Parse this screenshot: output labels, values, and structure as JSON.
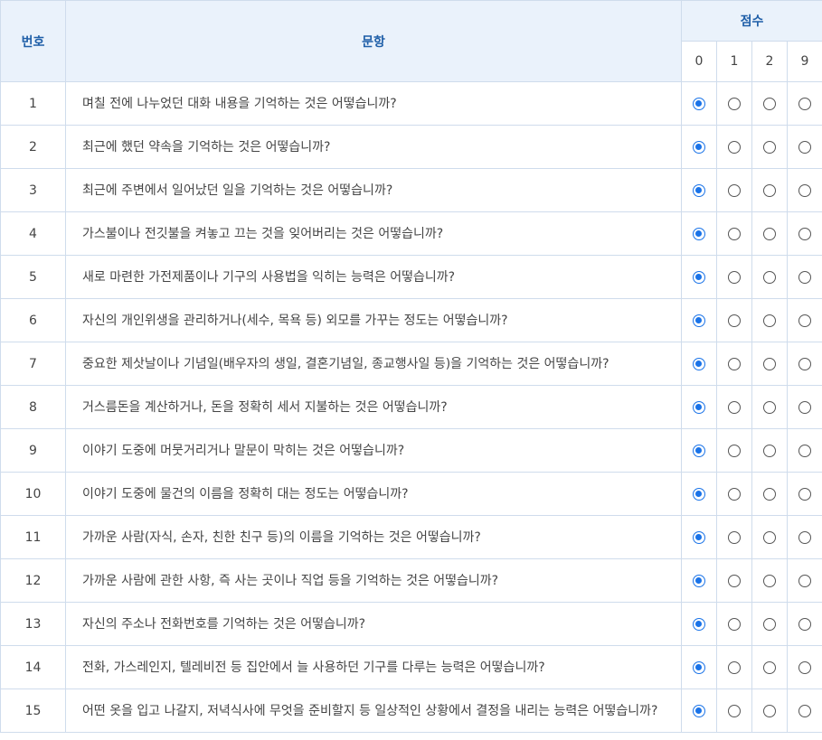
{
  "header": {
    "col_number": "번호",
    "col_question": "문항",
    "col_score": "점수",
    "score_options": [
      "0",
      "1",
      "2",
      "9"
    ]
  },
  "rows": [
    {
      "num": "1",
      "text": "며칠 전에 나누었던 대화 내용을 기억하는 것은 어떻습니까?",
      "selected": "0"
    },
    {
      "num": "2",
      "text": "최근에 했던 약속을 기억하는 것은 어떻습니까?",
      "selected": "0"
    },
    {
      "num": "3",
      "text": "최근에 주변에서 일어났던 일을 기억하는 것은 어떻습니까?",
      "selected": "0"
    },
    {
      "num": "4",
      "text": "가스불이나 전깃불을 켜놓고 끄는 것을 잊어버리는 것은 어떻습니까?",
      "selected": "0"
    },
    {
      "num": "5",
      "text": "새로 마련한 가전제품이나 기구의 사용법을 익히는 능력은 어떻습니까?",
      "selected": "0"
    },
    {
      "num": "6",
      "text": "자신의 개인위생을 관리하거나(세수, 목욕 등) 외모를 가꾸는 정도는 어떻습니까?",
      "selected": "0"
    },
    {
      "num": "7",
      "text": "중요한 제삿날이나 기념일(배우자의 생일, 결혼기념일, 종교행사일 등)을 기억하는 것은 어떻습니까?",
      "selected": "0"
    },
    {
      "num": "8",
      "text": "거스름돈을 계산하거나, 돈을 정확히 세서 지불하는 것은 어떻습니까?",
      "selected": "0"
    },
    {
      "num": "9",
      "text": "이야기 도중에 머뭇거리거나 말문이 막히는 것은 어떻습니까?",
      "selected": "0"
    },
    {
      "num": "10",
      "text": "이야기 도중에 물건의 이름을 정확히 대는 정도는 어떻습니까?",
      "selected": "0"
    },
    {
      "num": "11",
      "text": "가까운 사람(자식, 손자, 친한 친구 등)의 이름을 기억하는 것은 어떻습니까?",
      "selected": "0"
    },
    {
      "num": "12",
      "text": "가까운 사람에 관한 사항, 즉 사는 곳이나 직업 등을 기억하는 것은 어떻습니까?",
      "selected": "0"
    },
    {
      "num": "13",
      "text": "자신의 주소나 전화번호를 기억하는 것은 어떻습니까?",
      "selected": "0"
    },
    {
      "num": "14",
      "text": "전화, 가스레인지, 텔레비전 등 집안에서 늘 사용하던 기구를 다루는 능력은 어떻습니까?",
      "selected": "0"
    },
    {
      "num": "15",
      "text": "어떤 옷을 입고 나갈지, 저녁식사에 무엇을 준비할지 등 일상적인 상황에서 결정을 내리는 능력은 어떻습니까?",
      "selected": "0"
    }
  ],
  "colors": {
    "header_bg": "#eaf2fb",
    "header_text": "#1f5fa8",
    "border": "#cfdcec",
    "radio_selected": "#1a73e8"
  }
}
